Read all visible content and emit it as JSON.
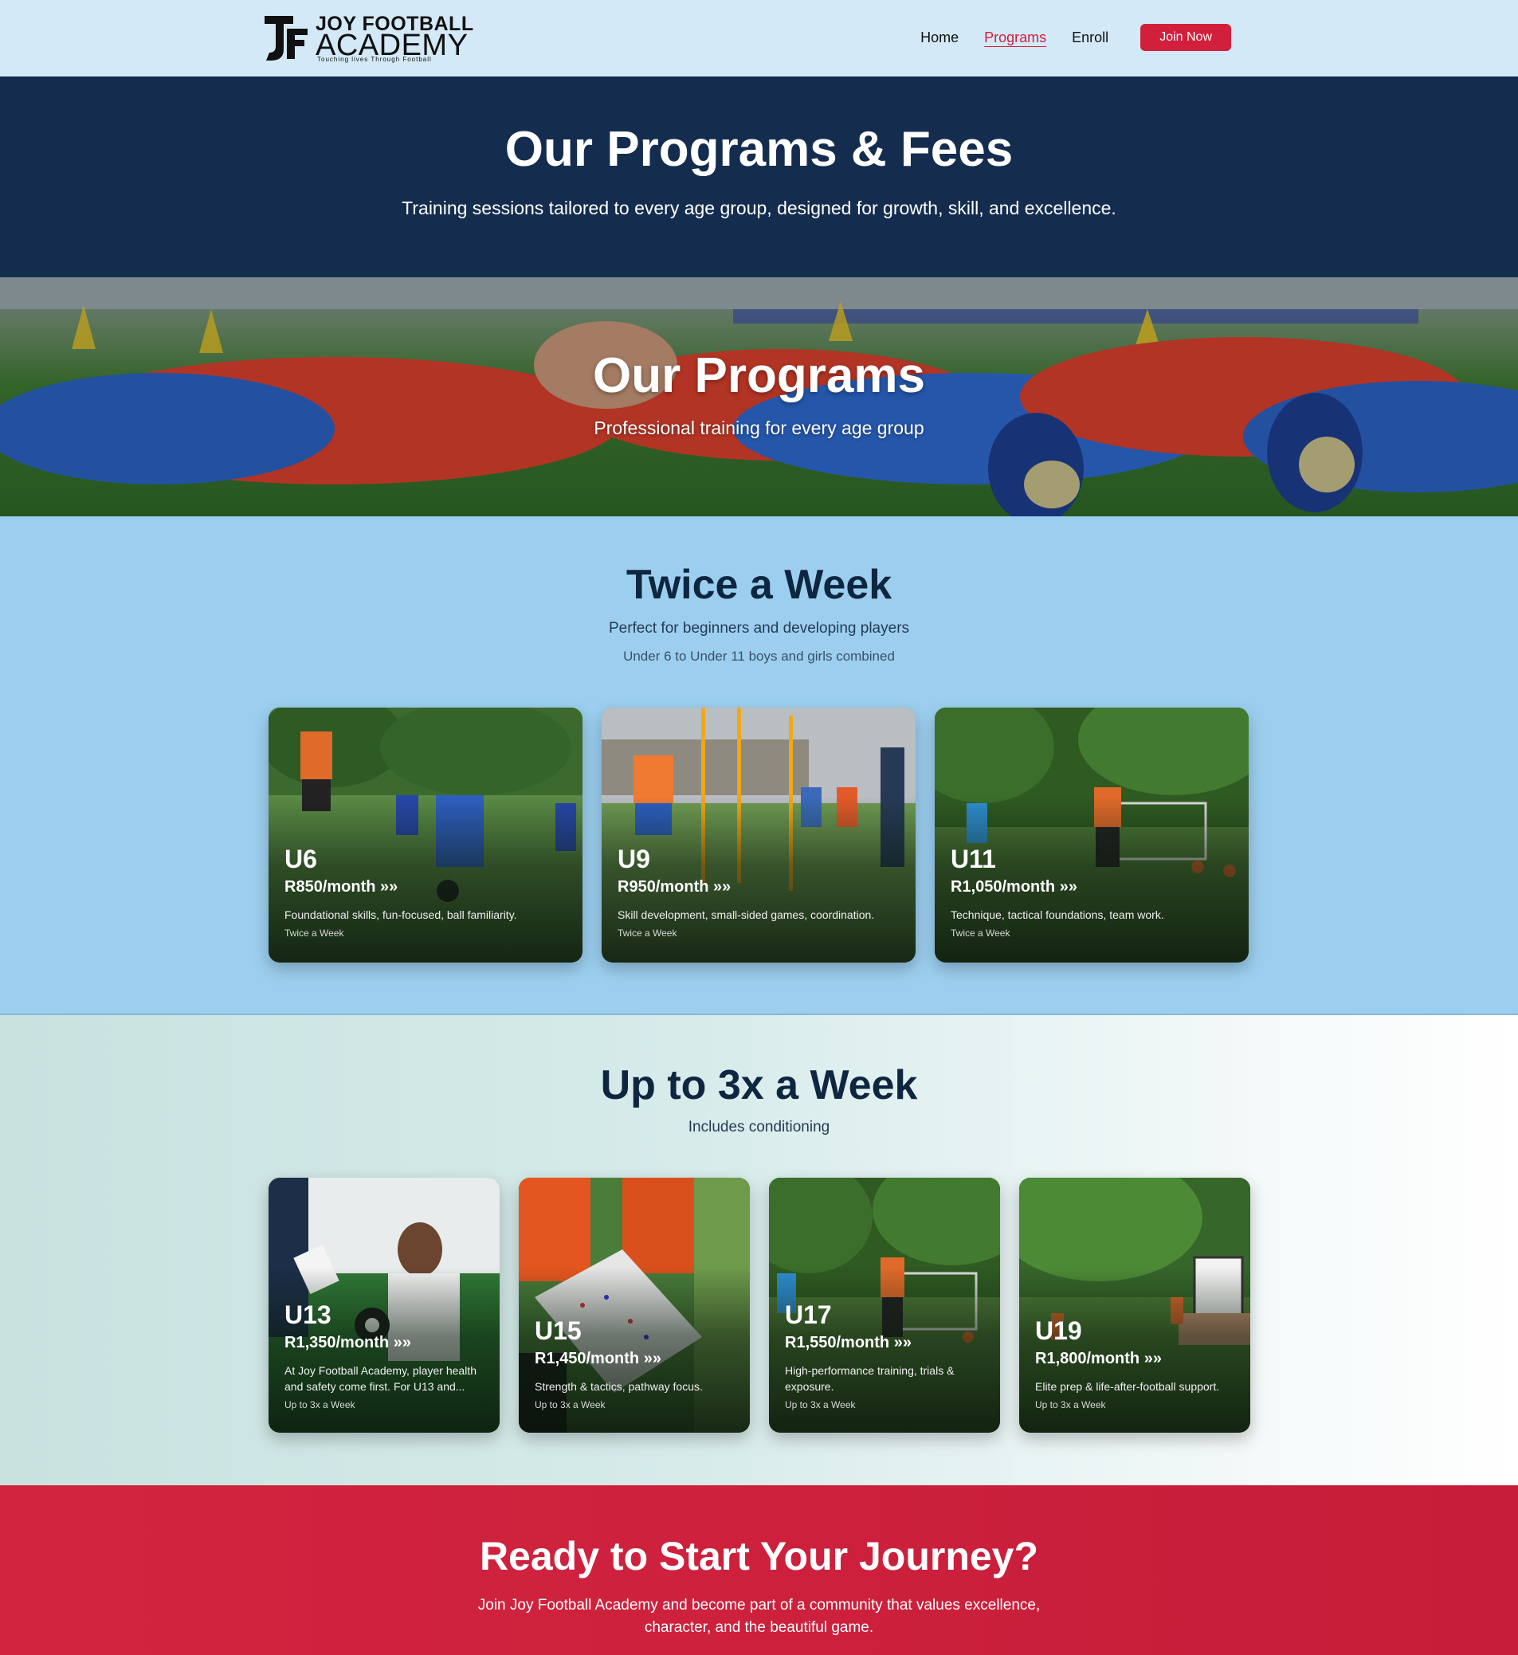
{
  "nav": {
    "logo": {
      "line1": "JOY FOOTBALL",
      "line2": "ACADEMY",
      "tagline": "Touching lives Through Football"
    },
    "links": [
      "Home",
      "Programs",
      "Enroll"
    ],
    "active": "Programs",
    "cta": "Join Now"
  },
  "header": {
    "title": "Our Programs & Fees",
    "subtitle": "Training sessions tailored to every age group, designed for growth, skill, and excellence."
  },
  "banner": {
    "title": "Our Programs",
    "subtitle": "Professional training for every age group"
  },
  "twice": {
    "title": "Twice a Week",
    "subtitle": "Perfect for beginners and developing players",
    "note": "Under 6 to Under 11 boys and girls combined",
    "cards": [
      {
        "age": "U6",
        "price": "R850/month",
        "arrows": "»»",
        "desc": "Foundational skills, fun-focused, ball familiarity.",
        "freq": "Twice a Week"
      },
      {
        "age": "U9",
        "price": "R950/month",
        "arrows": "»»",
        "desc": "Skill development, small-sided games, coordination.",
        "freq": "Twice a Week"
      },
      {
        "age": "U11",
        "price": "R1,050/month",
        "arrows": "»»",
        "desc": "Technique, tactical foundations, team work.",
        "freq": "Twice a Week"
      }
    ]
  },
  "thrice": {
    "title": "Up to 3x a Week",
    "subtitle": "Includes conditioning",
    "cards": [
      {
        "age": "U13",
        "price": "R1,350/month",
        "arrows": "»»",
        "desc": "At Joy Football Academy, player health and safety come first. For U13 and...",
        "freq": "Up to 3x a Week"
      },
      {
        "age": "U15",
        "price": "R1,450/month",
        "arrows": "»»",
        "desc": "Strength & tactics, pathway focus.",
        "freq": "Up to 3x a Week"
      },
      {
        "age": "U17",
        "price": "R1,550/month",
        "arrows": "»»",
        "desc": "High-performance training, trials & exposure.",
        "freq": "Up to 3x a Week"
      },
      {
        "age": "U19",
        "price": "R1,800/month",
        "arrows": "»»",
        "desc": "Elite prep & life-after-football support.",
        "freq": "Up to 3x a Week"
      }
    ]
  },
  "cta": {
    "title": "Ready to Start Your Journey?",
    "text": "Join Joy Football Academy and become part of a community that values excellence, character, and the beautiful game."
  },
  "colors": {
    "navy": "#142d4f",
    "accent_red": "#d21f3c",
    "sky": "#9ccfef",
    "nav_bg": "#d3e9f7"
  }
}
